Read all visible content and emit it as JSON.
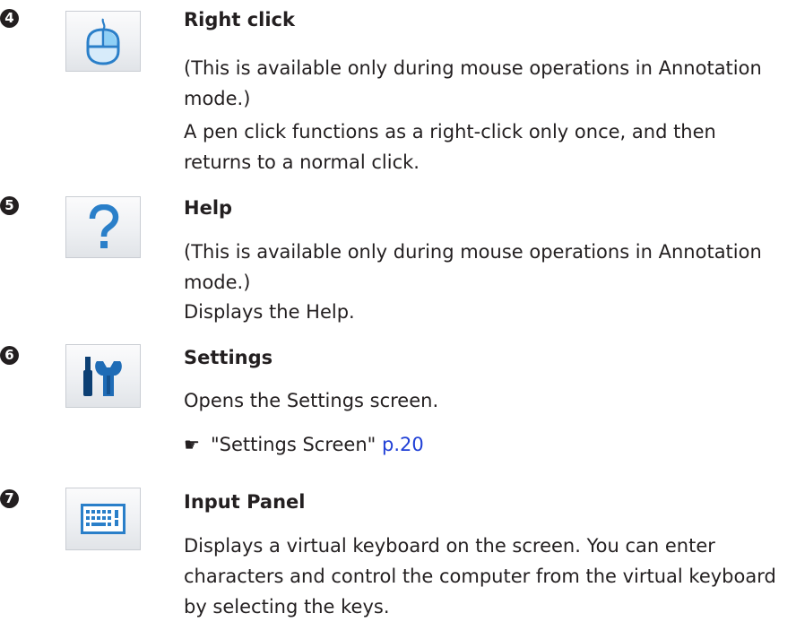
{
  "items": [
    {
      "marker": "4",
      "icon": "mouse-icon",
      "title": "Right click",
      "paragraphs": [
        "(This is available only during mouse operations in Annotation mode.)",
        "A pen click functions as a right-click only once, and then returns to a normal click."
      ]
    },
    {
      "marker": "5",
      "icon": "question-icon",
      "title": "Help",
      "paragraphs": [
        "(This is available only during mouse operations in Annotation mode.)",
        "Displays the Help."
      ]
    },
    {
      "marker": "6",
      "icon": "tools-icon",
      "title": "Settings",
      "paragraphs": [
        "Opens the Settings screen."
      ],
      "reference": {
        "icon": "pointing-hand-icon",
        "text": "\"Settings Screen\"",
        "page": "p.20"
      }
    },
    {
      "marker": "7",
      "icon": "keyboard-icon",
      "title": "Input Panel",
      "paragraphs": [
        "Displays a virtual keyboard on the screen. You can enter characters and control the computer from the virtual keyboard by selecting the keys."
      ]
    }
  ],
  "colors": {
    "text": "#231f20",
    "link": "#1f3fd6",
    "icon_blue": "#2a7fc9"
  }
}
